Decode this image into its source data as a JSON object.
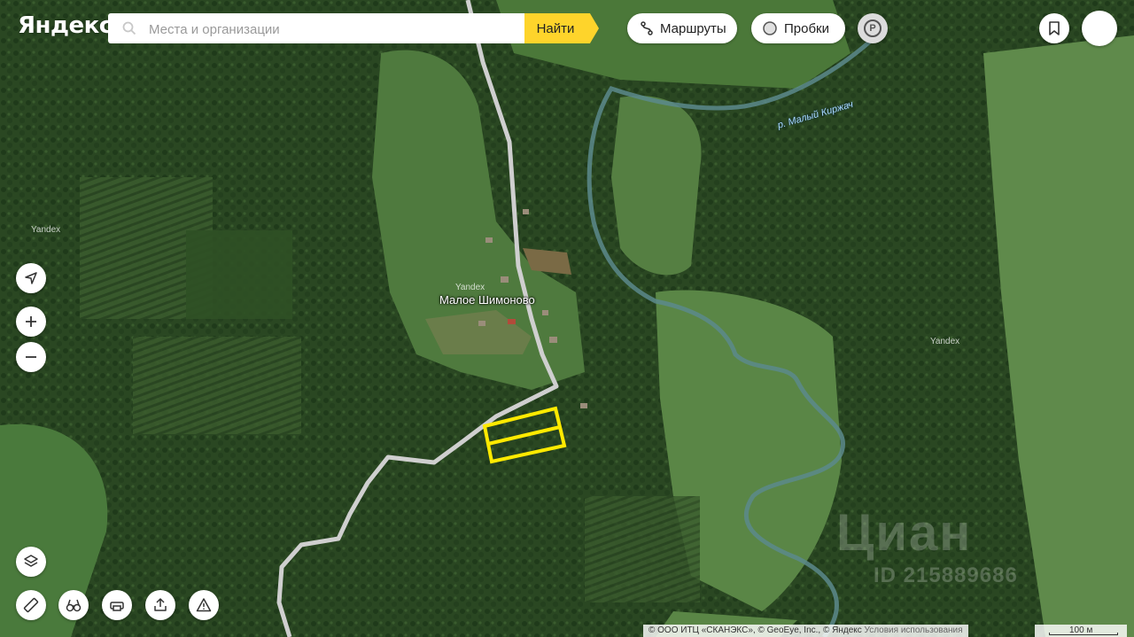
{
  "brand": {
    "logo": "Яндекс"
  },
  "search": {
    "placeholder": "Места и организации",
    "button": "Найти"
  },
  "header": {
    "routes_label": "Маршруты",
    "traffic_label": "Пробки",
    "parking_symbol": "P"
  },
  "map": {
    "village_label": "Малое Шимоново",
    "river_label": "р. Малый Киржач",
    "watermarks": [
      "Yandex",
      "Yandex",
      "Yandex"
    ],
    "listing_watermark": "Циан",
    "listing_id": "ID 215889686"
  },
  "controls": {
    "left": [
      "location-arrow",
      "zoom-in",
      "zoom-out"
    ],
    "bottom": [
      "layers",
      "ruler",
      "panorama",
      "print",
      "share",
      "report-error"
    ]
  },
  "footer": {
    "copyright": "© ООО ИТЦ «СКАНЭКС», © GeoEye, Inc., © Яндекс",
    "terms": "Условия использования",
    "scale": "100 м"
  },
  "colors": {
    "accent": "#fed42b",
    "plot_outline": "#ffea00",
    "road": "#cfcfcf",
    "river": "#a9d8ff"
  }
}
